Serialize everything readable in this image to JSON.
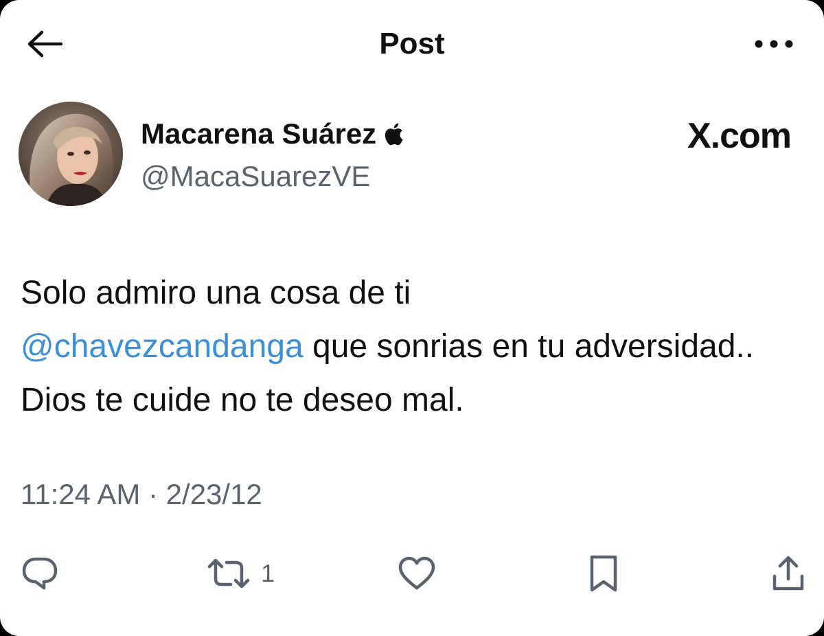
{
  "header": {
    "title": "Post",
    "back_icon": "arrow-left-icon",
    "more_icon": "more-horizontal-icon"
  },
  "author": {
    "name": "Macarena Suárez",
    "handle": "@MacaSuarezVE",
    "badge_icon": "apple-logo-icon",
    "avatar": "profile-photo"
  },
  "brand": {
    "text": "X.com"
  },
  "post": {
    "text_before": "Solo admiro una cosa de ti",
    "mention": "@chavezcandanga",
    "text_after": " que sonrias en tu adversidad.. Dios te cuide no te deseo mal.",
    "timestamp": "11:24 AM · 2/23/12"
  },
  "actions": {
    "reply_icon": "reply-bubble-icon",
    "repost_icon": "repost-icon",
    "repost_count": "1",
    "like_icon": "heart-icon",
    "bookmark_icon": "bookmark-icon",
    "share_icon": "share-icon"
  },
  "colors": {
    "mention": "#3a8fd6",
    "secondary_text": "#59636e",
    "primary_text": "#111111",
    "background": "#ffffff"
  }
}
